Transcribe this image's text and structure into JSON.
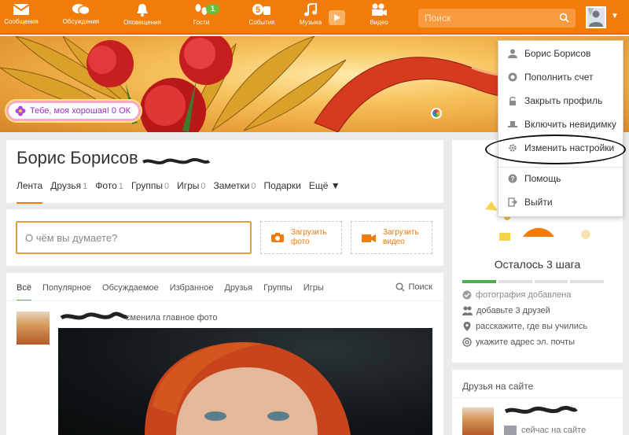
{
  "nav": {
    "items": [
      {
        "label": "Сообщения",
        "icon": "envelope-icon"
      },
      {
        "label": "Обсуждения",
        "icon": "chat-bubbles-icon"
      },
      {
        "label": "Оповещения",
        "icon": "bell-icon"
      },
      {
        "label": "Гости",
        "icon": "footprints-icon",
        "badge": "1"
      },
      {
        "label": "События",
        "icon": "five-hand-icon"
      },
      {
        "label": "Музыка",
        "icon": "music-note-icon"
      },
      {
        "label": "Видео",
        "icon": "film-camera-icon"
      }
    ],
    "search_placeholder": "Поиск"
  },
  "banner": {
    "gift_text": "Тебе, моя хорошая! 0 ОК"
  },
  "profile": {
    "name": "Борис Борисов",
    "tabs": [
      {
        "label": "Лента",
        "count": ""
      },
      {
        "label": "Друзья",
        "count": "1"
      },
      {
        "label": "Фото",
        "count": "1"
      },
      {
        "label": "Группы",
        "count": "0"
      },
      {
        "label": "Игры",
        "count": "0"
      },
      {
        "label": "Заметки",
        "count": "0"
      },
      {
        "label": "Подарки",
        "count": ""
      },
      {
        "label": "Ещё ▼",
        "count": ""
      }
    ]
  },
  "post": {
    "placeholder": "О чём вы думаете?",
    "upload_photo": "Загрузить\nфото",
    "upload_video": "Загрузить\nвидео"
  },
  "feed": {
    "tabs": [
      "Всё",
      "Популярное",
      "Обсуждаемое",
      "Избранное",
      "Друзья",
      "Группы",
      "Игры"
    ],
    "search_label": "Поиск",
    "action_text": "сменила главное фото"
  },
  "steps": {
    "title": "Осталось 3 шага",
    "items": [
      {
        "label": "фотография добавлена",
        "icon": "check-circle-icon"
      },
      {
        "label": "добавьте 3 друзей",
        "icon": "people-icon"
      },
      {
        "label": "расскажите, где вы учились",
        "icon": "location-pin-icon"
      },
      {
        "label": "укажите адрес эл. почты",
        "icon": "at-sign-icon"
      }
    ]
  },
  "friends": {
    "title": "Друзья на сайте",
    "status": "сейчас на сайте"
  },
  "dropdown": {
    "items": [
      {
        "label": "Борис Борисов",
        "icon": "user-icon"
      },
      {
        "label": "Пополнить счет",
        "icon": "coin-icon"
      },
      {
        "label": "Закрыть профиль",
        "icon": "lock-icon"
      },
      {
        "label": "Включить невидимку",
        "icon": "hat-icon"
      },
      {
        "label": "Изменить настройки",
        "icon": "gear-icon"
      },
      {
        "label": "Помощь",
        "icon": "help-icon"
      },
      {
        "label": "Выйти",
        "icon": "logout-icon"
      }
    ]
  },
  "colors": {
    "brand_orange": "#f27c0a",
    "progress_green": "#4caf50"
  }
}
